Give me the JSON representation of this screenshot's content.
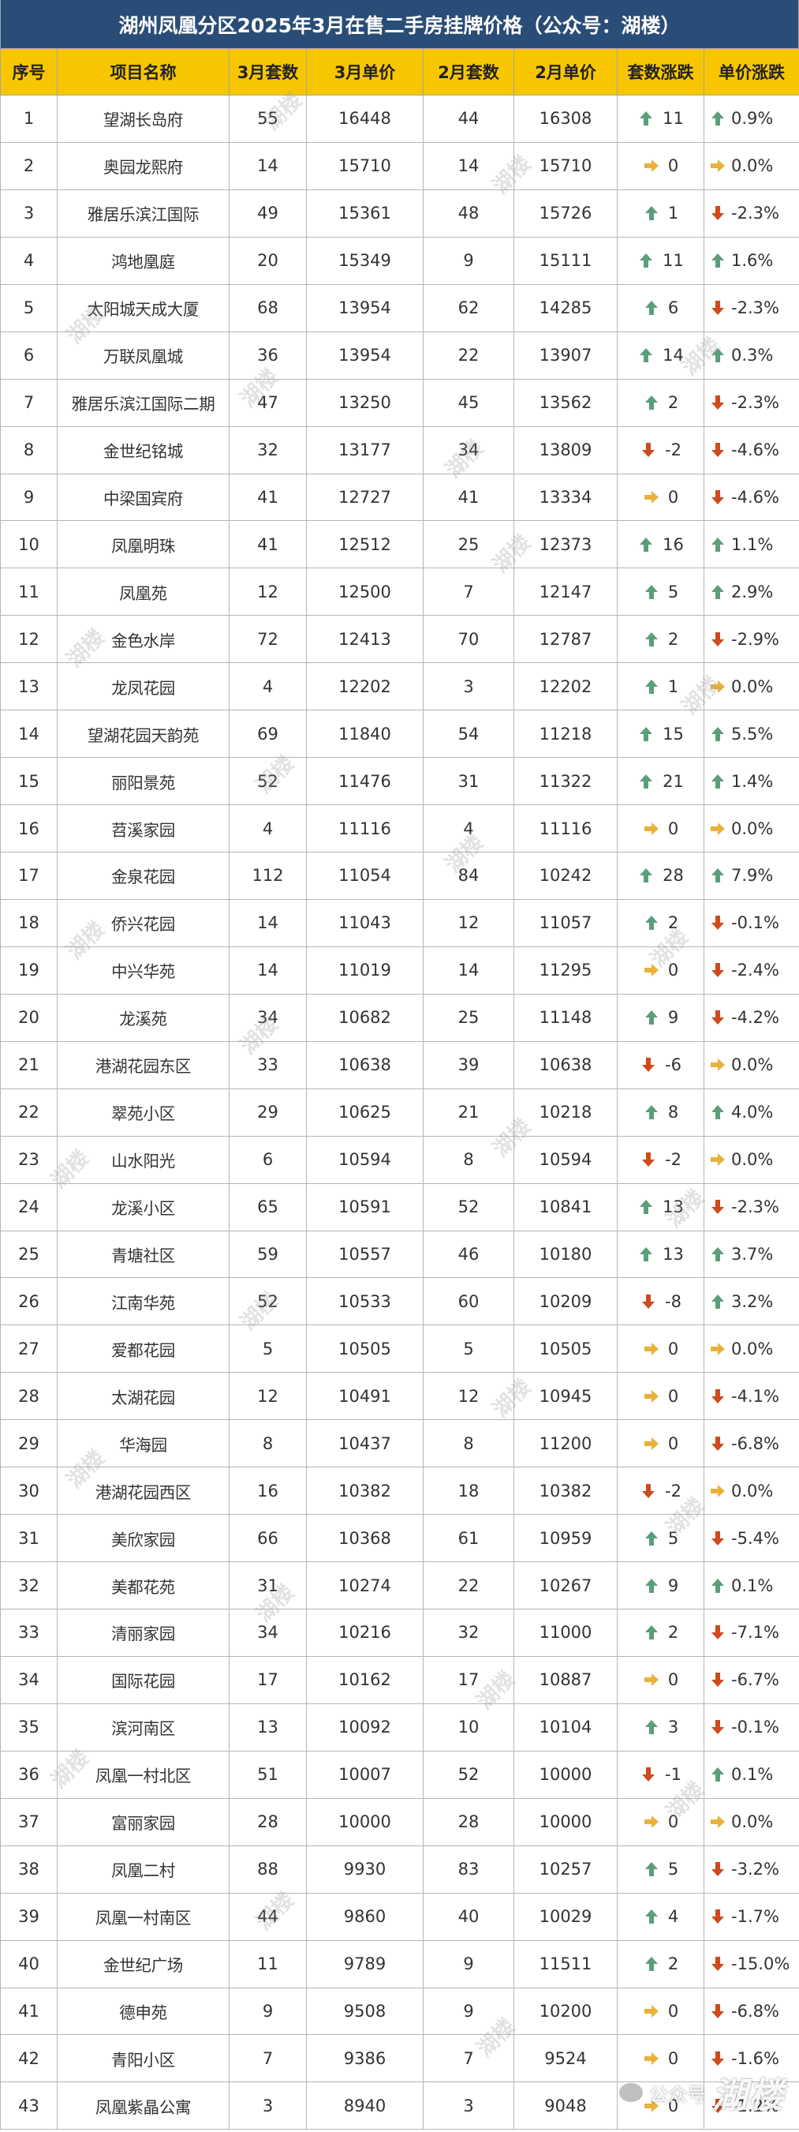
{
  "title": "湖州凤凰分区2025年3月在售二手房挂牌价格（公众号：湖楼）",
  "headers": [
    "序号",
    "项目名称",
    "3月套数",
    "3月单价",
    "2月套数",
    "2月单价",
    "套数涨跌",
    "单价涨跌"
  ],
  "colors": {
    "title_bg": "#2a4d77",
    "header_bg": "#f7c600",
    "up": "#5a9e7a",
    "down": "#cf4a1c",
    "flat": "#e9b13a"
  },
  "icons": {
    "up": "arrow-up-icon",
    "down": "arrow-down-icon",
    "flat": "arrow-right-icon"
  },
  "watermark": "湖楼",
  "footer": {
    "label": "公众号",
    "brand": "湖楼"
  },
  "rows": [
    {
      "no": "1",
      "name": "望湖长岛府",
      "m3_count": "55",
      "m3_price": "16448",
      "m2_count": "44",
      "m2_price": "16308",
      "count_change": "11",
      "count_dir": "up",
      "price_change": "0.9%",
      "price_dir": "up"
    },
    {
      "no": "2",
      "name": "奥园龙熙府",
      "m3_count": "14",
      "m3_price": "15710",
      "m2_count": "14",
      "m2_price": "15710",
      "count_change": "0",
      "count_dir": "flat",
      "price_change": "0.0%",
      "price_dir": "flat"
    },
    {
      "no": "3",
      "name": "雅居乐滨江国际",
      "m3_count": "49",
      "m3_price": "15361",
      "m2_count": "48",
      "m2_price": "15726",
      "count_change": "1",
      "count_dir": "up",
      "price_change": "-2.3%",
      "price_dir": "down"
    },
    {
      "no": "4",
      "name": "鸿地凰庭",
      "m3_count": "20",
      "m3_price": "15349",
      "m2_count": "9",
      "m2_price": "15111",
      "count_change": "11",
      "count_dir": "up",
      "price_change": "1.6%",
      "price_dir": "up"
    },
    {
      "no": "5",
      "name": "太阳城天成大厦",
      "m3_count": "68",
      "m3_price": "13954",
      "m2_count": "62",
      "m2_price": "14285",
      "count_change": "6",
      "count_dir": "up",
      "price_change": "-2.3%",
      "price_dir": "down"
    },
    {
      "no": "6",
      "name": "万联凤凰城",
      "m3_count": "36",
      "m3_price": "13954",
      "m2_count": "22",
      "m2_price": "13907",
      "count_change": "14",
      "count_dir": "up",
      "price_change": "0.3%",
      "price_dir": "up"
    },
    {
      "no": "7",
      "name": "雅居乐滨江国际二期",
      "m3_count": "47",
      "m3_price": "13250",
      "m2_count": "45",
      "m2_price": "13562",
      "count_change": "2",
      "count_dir": "up",
      "price_change": "-2.3%",
      "price_dir": "down"
    },
    {
      "no": "8",
      "name": "金世纪铭城",
      "m3_count": "32",
      "m3_price": "13177",
      "m2_count": "34",
      "m2_price": "13809",
      "count_change": "-2",
      "count_dir": "down",
      "price_change": "-4.6%",
      "price_dir": "down"
    },
    {
      "no": "9",
      "name": "中梁国宾府",
      "m3_count": "41",
      "m3_price": "12727",
      "m2_count": "41",
      "m2_price": "13334",
      "count_change": "0",
      "count_dir": "flat",
      "price_change": "-4.6%",
      "price_dir": "down"
    },
    {
      "no": "10",
      "name": "凤凰明珠",
      "m3_count": "41",
      "m3_price": "12512",
      "m2_count": "25",
      "m2_price": "12373",
      "count_change": "16",
      "count_dir": "up",
      "price_change": "1.1%",
      "price_dir": "up"
    },
    {
      "no": "11",
      "name": "凤凰苑",
      "m3_count": "12",
      "m3_price": "12500",
      "m2_count": "7",
      "m2_price": "12147",
      "count_change": "5",
      "count_dir": "up",
      "price_change": "2.9%",
      "price_dir": "up"
    },
    {
      "no": "12",
      "name": "金色水岸",
      "m3_count": "72",
      "m3_price": "12413",
      "m2_count": "70",
      "m2_price": "12787",
      "count_change": "2",
      "count_dir": "up",
      "price_change": "-2.9%",
      "price_dir": "down"
    },
    {
      "no": "13",
      "name": "龙凤花园",
      "m3_count": "4",
      "m3_price": "12202",
      "m2_count": "3",
      "m2_price": "12202",
      "count_change": "1",
      "count_dir": "up",
      "price_change": "0.0%",
      "price_dir": "flat"
    },
    {
      "no": "14",
      "name": "望湖花园天韵苑",
      "m3_count": "69",
      "m3_price": "11840",
      "m2_count": "54",
      "m2_price": "11218",
      "count_change": "15",
      "count_dir": "up",
      "price_change": "5.5%",
      "price_dir": "up"
    },
    {
      "no": "15",
      "name": "丽阳景苑",
      "m3_count": "52",
      "m3_price": "11476",
      "m2_count": "31",
      "m2_price": "11322",
      "count_change": "21",
      "count_dir": "up",
      "price_change": "1.4%",
      "price_dir": "up"
    },
    {
      "no": "16",
      "name": "苕溪家园",
      "m3_count": "4",
      "m3_price": "11116",
      "m2_count": "4",
      "m2_price": "11116",
      "count_change": "0",
      "count_dir": "flat",
      "price_change": "0.0%",
      "price_dir": "flat"
    },
    {
      "no": "17",
      "name": "金泉花园",
      "m3_count": "112",
      "m3_price": "11054",
      "m2_count": "84",
      "m2_price": "10242",
      "count_change": "28",
      "count_dir": "up",
      "price_change": "7.9%",
      "price_dir": "up"
    },
    {
      "no": "18",
      "name": "侨兴花园",
      "m3_count": "14",
      "m3_price": "11043",
      "m2_count": "12",
      "m2_price": "11057",
      "count_change": "2",
      "count_dir": "up",
      "price_change": "-0.1%",
      "price_dir": "down"
    },
    {
      "no": "19",
      "name": "中兴华苑",
      "m3_count": "14",
      "m3_price": "11019",
      "m2_count": "14",
      "m2_price": "11295",
      "count_change": "0",
      "count_dir": "flat",
      "price_change": "-2.4%",
      "price_dir": "down"
    },
    {
      "no": "20",
      "name": "龙溪苑",
      "m3_count": "34",
      "m3_price": "10682",
      "m2_count": "25",
      "m2_price": "11148",
      "count_change": "9",
      "count_dir": "up",
      "price_change": "-4.2%",
      "price_dir": "down"
    },
    {
      "no": "21",
      "name": "港湖花园东区",
      "m3_count": "33",
      "m3_price": "10638",
      "m2_count": "39",
      "m2_price": "10638",
      "count_change": "-6",
      "count_dir": "down",
      "price_change": "0.0%",
      "price_dir": "flat"
    },
    {
      "no": "22",
      "name": "翠苑小区",
      "m3_count": "29",
      "m3_price": "10625",
      "m2_count": "21",
      "m2_price": "10218",
      "count_change": "8",
      "count_dir": "up",
      "price_change": "4.0%",
      "price_dir": "up"
    },
    {
      "no": "23",
      "name": "山水阳光",
      "m3_count": "6",
      "m3_price": "10594",
      "m2_count": "8",
      "m2_price": "10594",
      "count_change": "-2",
      "count_dir": "down",
      "price_change": "0.0%",
      "price_dir": "flat"
    },
    {
      "no": "24",
      "name": "龙溪小区",
      "m3_count": "65",
      "m3_price": "10591",
      "m2_count": "52",
      "m2_price": "10841",
      "count_change": "13",
      "count_dir": "up",
      "price_change": "-2.3%",
      "price_dir": "down"
    },
    {
      "no": "25",
      "name": "青塘社区",
      "m3_count": "59",
      "m3_price": "10557",
      "m2_count": "46",
      "m2_price": "10180",
      "count_change": "13",
      "count_dir": "up",
      "price_change": "3.7%",
      "price_dir": "up"
    },
    {
      "no": "26",
      "name": "江南华苑",
      "m3_count": "52",
      "m3_price": "10533",
      "m2_count": "60",
      "m2_price": "10209",
      "count_change": "-8",
      "count_dir": "down",
      "price_change": "3.2%",
      "price_dir": "up"
    },
    {
      "no": "27",
      "name": "爱都花园",
      "m3_count": "5",
      "m3_price": "10505",
      "m2_count": "5",
      "m2_price": "10505",
      "count_change": "0",
      "count_dir": "flat",
      "price_change": "0.0%",
      "price_dir": "flat"
    },
    {
      "no": "28",
      "name": "太湖花园",
      "m3_count": "12",
      "m3_price": "10491",
      "m2_count": "12",
      "m2_price": "10945",
      "count_change": "0",
      "count_dir": "flat",
      "price_change": "-4.1%",
      "price_dir": "down"
    },
    {
      "no": "29",
      "name": "华海园",
      "m3_count": "8",
      "m3_price": "10437",
      "m2_count": "8",
      "m2_price": "11200",
      "count_change": "0",
      "count_dir": "flat",
      "price_change": "-6.8%",
      "price_dir": "down"
    },
    {
      "no": "30",
      "name": "港湖花园西区",
      "m3_count": "16",
      "m3_price": "10382",
      "m2_count": "18",
      "m2_price": "10382",
      "count_change": "-2",
      "count_dir": "down",
      "price_change": "0.0%",
      "price_dir": "flat"
    },
    {
      "no": "31",
      "name": "美欣家园",
      "m3_count": "66",
      "m3_price": "10368",
      "m2_count": "61",
      "m2_price": "10959",
      "count_change": "5",
      "count_dir": "up",
      "price_change": "-5.4%",
      "price_dir": "down"
    },
    {
      "no": "32",
      "name": "美都花苑",
      "m3_count": "31",
      "m3_price": "10274",
      "m2_count": "22",
      "m2_price": "10267",
      "count_change": "9",
      "count_dir": "up",
      "price_change": "0.1%",
      "price_dir": "up"
    },
    {
      "no": "33",
      "name": "清丽家园",
      "m3_count": "34",
      "m3_price": "10216",
      "m2_count": "32",
      "m2_price": "11000",
      "count_change": "2",
      "count_dir": "up",
      "price_change": "-7.1%",
      "price_dir": "down"
    },
    {
      "no": "34",
      "name": "国际花园",
      "m3_count": "17",
      "m3_price": "10162",
      "m2_count": "17",
      "m2_price": "10887",
      "count_change": "0",
      "count_dir": "flat",
      "price_change": "-6.7%",
      "price_dir": "down"
    },
    {
      "no": "35",
      "name": "滨河南区",
      "m3_count": "13",
      "m3_price": "10092",
      "m2_count": "10",
      "m2_price": "10104",
      "count_change": "3",
      "count_dir": "up",
      "price_change": "-0.1%",
      "price_dir": "down"
    },
    {
      "no": "36",
      "name": "凤凰一村北区",
      "m3_count": "51",
      "m3_price": "10007",
      "m2_count": "52",
      "m2_price": "10000",
      "count_change": "-1",
      "count_dir": "down",
      "price_change": "0.1%",
      "price_dir": "up"
    },
    {
      "no": "37",
      "name": "富丽家园",
      "m3_count": "28",
      "m3_price": "10000",
      "m2_count": "28",
      "m2_price": "10000",
      "count_change": "0",
      "count_dir": "flat",
      "price_change": "0.0%",
      "price_dir": "flat"
    },
    {
      "no": "38",
      "name": "凤凰二村",
      "m3_count": "88",
      "m3_price": "9930",
      "m2_count": "83",
      "m2_price": "10257",
      "count_change": "5",
      "count_dir": "up",
      "price_change": "-3.2%",
      "price_dir": "down"
    },
    {
      "no": "39",
      "name": "凤凰一村南区",
      "m3_count": "44",
      "m3_price": "9860",
      "m2_count": "40",
      "m2_price": "10029",
      "count_change": "4",
      "count_dir": "up",
      "price_change": "-1.7%",
      "price_dir": "down"
    },
    {
      "no": "40",
      "name": "金世纪广场",
      "m3_count": "11",
      "m3_price": "9789",
      "m2_count": "9",
      "m2_price": "11511",
      "count_change": "2",
      "count_dir": "up",
      "price_change": "-15.0%",
      "price_dir": "down"
    },
    {
      "no": "41",
      "name": "德申苑",
      "m3_count": "9",
      "m3_price": "9508",
      "m2_count": "9",
      "m2_price": "10200",
      "count_change": "0",
      "count_dir": "flat",
      "price_change": "-6.8%",
      "price_dir": "down"
    },
    {
      "no": "42",
      "name": "青阳小区",
      "m3_count": "7",
      "m3_price": "9386",
      "m2_count": "7",
      "m2_price": "9524",
      "count_change": "0",
      "count_dir": "flat",
      "price_change": "-1.6%",
      "price_dir": "down"
    },
    {
      "no": "43",
      "name": "凤凰紫晶公寓",
      "m3_count": "3",
      "m3_price": "8940",
      "m2_count": "3",
      "m2_price": "9048",
      "count_change": "0",
      "count_dir": "flat",
      "price_change": "-1.2%",
      "price_dir": "down"
    }
  ]
}
